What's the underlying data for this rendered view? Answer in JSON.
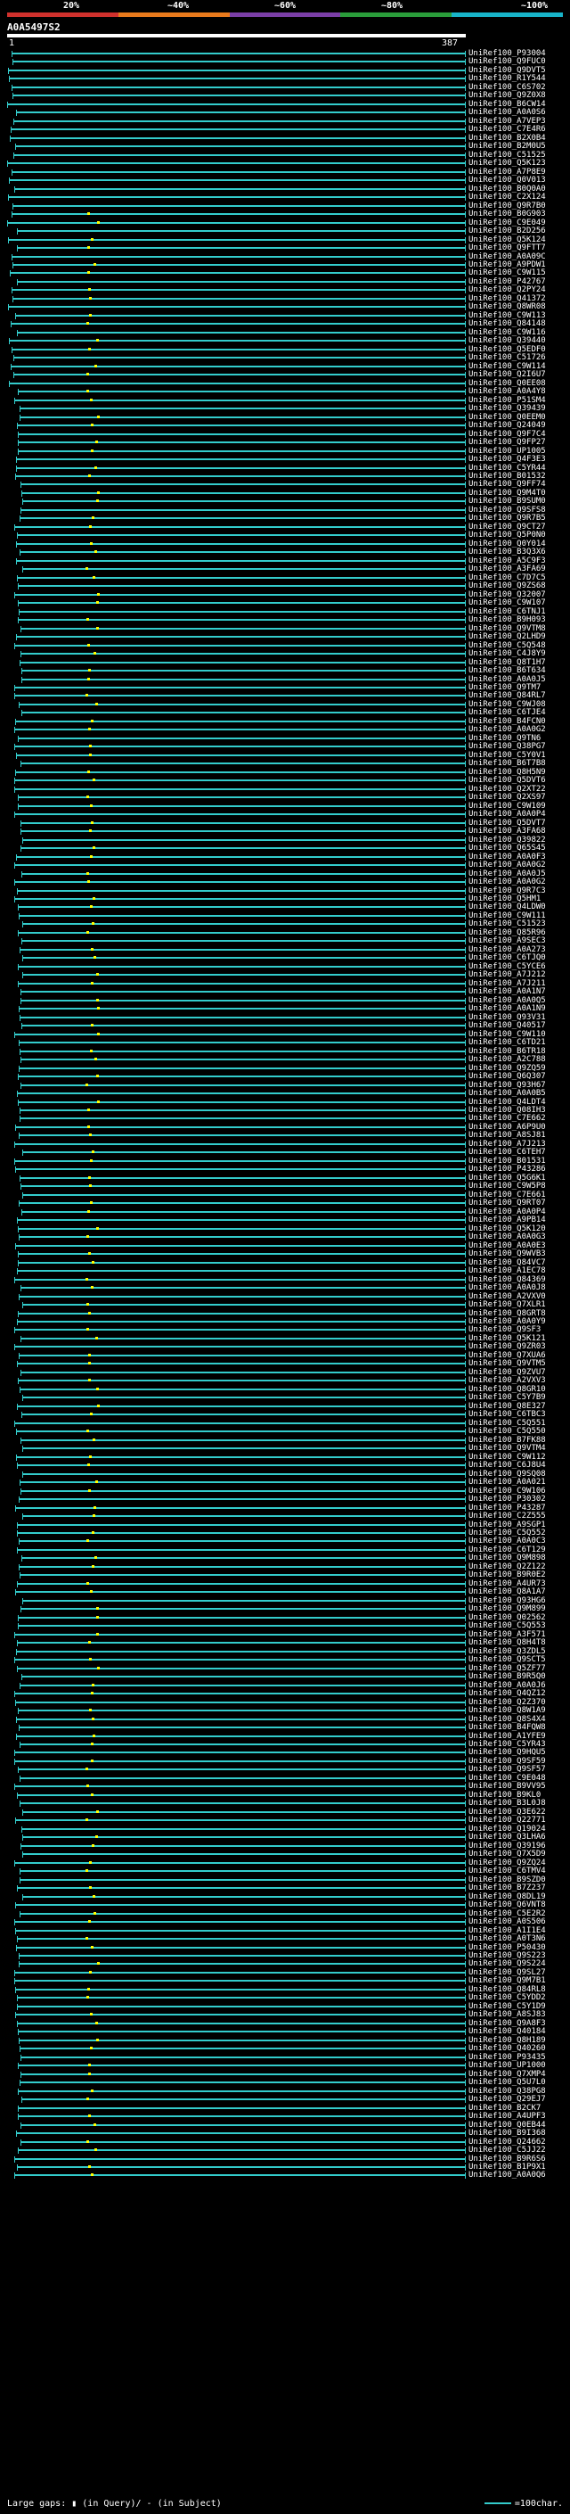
{
  "header": {
    "percent_labels": [
      "20%",
      "~40%",
      "~60%",
      "~80%",
      "~100%"
    ],
    "color_scale": [
      "#d0312d",
      "#e97a1c",
      "#7b3fa7",
      "#2a9d3a",
      "#18b4c9"
    ],
    "query_id": "A0A5497S2",
    "query_start": "1",
    "query_end": "387"
  },
  "hit_color": "#3cc",
  "hit_ids": [
    "UniRef100_P93004",
    "UniRef100_Q9FUC0",
    "UniRef100_Q9DVT5",
    "UniRef100_R1Y544",
    "UniRef100_C6S702",
    "UniRef100_Q9Z0X8",
    "UniRef100_B6CW14",
    "UniRef100_A0A0S6",
    "UniRef100_A7VEP3",
    "UniRef100_C7E4R6",
    "UniRef100_B2X0B4",
    "UniRef100_B2M0U5",
    "UniRef100_C51525",
    "UniRef100_Q5K123",
    "UniRef100_A7P8E9",
    "UniRef100_Q0V013",
    "UniRef100_B0Q0A0",
    "UniRef100_C2X124",
    "UniRef100_Q9R7B0",
    "UniRef100_B0G903",
    "UniRef100_C9E049",
    "UniRef100_B2D256",
    "UniRef100_Q5K124",
    "UniRef100_Q9FTT7",
    "UniRef100_A0A09C",
    "UniRef100_A9PDW1",
    "UniRef100_C9W115",
    "UniRef100_P42767",
    "UniRef100_Q2PY24",
    "UniRef100_Q41372",
    "UniRef100_Q8WR08",
    "UniRef100_C9W113",
    "UniRef100_Q84148",
    "UniRef100_C9W116",
    "UniRef100_Q39440",
    "UniRef100_Q5EDF0",
    "UniRef100_C51726",
    "UniRef100_C9W114",
    "UniRef100_Q2I6U7",
    "UniRef100_Q0EE08",
    "UniRef100_A0A4Y8",
    "UniRef100_P51SM4",
    "UniRef100_Q39439",
    "UniRef100_Q0EEM0",
    "UniRef100_Q24049",
    "UniRef100_Q9F7C4",
    "UniRef100_Q9FP27",
    "UniRef100_UP1005",
    "UniRef100_Q4F3E3",
    "UniRef100_C5YR44",
    "UniRef100_B01532",
    "UniRef100_Q9FF74",
    "UniRef100_Q9M4T0",
    "UniRef100_B9SUM0",
    "UniRef100_Q9SFS8",
    "UniRef100_Q9R7B5",
    "UniRef100_Q9CT27",
    "UniRef100_Q5P0N0",
    "UniRef100_Q0Y014",
    "UniRef100_B3Q3X6",
    "UniRef100_A5C9F3",
    "UniRef100_A3FA69",
    "UniRef100_C7D7C5",
    "UniRef100_Q9ZS68",
    "UniRef100_Q32007",
    "UniRef100_C9W107",
    "UniRef100_C6TNJ1",
    "UniRef100_B9H093",
    "UniRef100_Q9VTM8",
    "UniRef100_Q2LHD9",
    "UniRef100_C5Q548",
    "UniRef100_C4J8Y9",
    "UniRef100_Q8T1H7",
    "UniRef100_B6T634",
    "UniRef100_A0A0J5",
    "UniRef100_Q9TM7",
    "UniRef100_Q84RL7",
    "UniRef100_C9WJ08",
    "UniRef100_C6TJE4",
    "UniRef100_B4FCN0",
    "UniRef100_A0A0G2",
    "UniRef100_Q9TN6",
    "UniRef100_Q38PG7",
    "UniRef100_C5Y0V1",
    "UniRef100_B6T7B8",
    "UniRef100_Q8H5N9",
    "UniRef100_Q5DVT6",
    "UniRef100_Q2XT22",
    "UniRef100_Q2XS97",
    "UniRef100_C9W109",
    "UniRef100_A0A0P4",
    "UniRef100_Q5DVT7",
    "UniRef100_A3FA68",
    "UniRef100_Q39822",
    "UniRef100_Q65S45",
    "UniRef100_A0A0F3",
    "UniRef100_A0A0G2",
    "UniRef100_A0A0J5",
    "UniRef100_A0A0G2",
    "UniRef100_Q9R7C3",
    "UniRef100_Q5HM1",
    "UniRef100_Q4LDW0",
    "UniRef100_C9W111",
    "UniRef100_C51523",
    "UniRef100_Q85R96",
    "UniRef100_A9SEC3",
    "UniRef100_A0A273",
    "UniRef100_C6TJQ0",
    "UniRef100_C5YCE6",
    "UniRef100_A7J212",
    "UniRef100_A7J211",
    "UniRef100_A0A1N7",
    "UniRef100_A0A0Q5",
    "UniRef100_A0A1N9",
    "UniRef100_Q93V31",
    "UniRef100_Q40517",
    "UniRef100_C9W110",
    "UniRef100_C6TD21",
    "UniRef100_B6TR18",
    "UniRef100_A2C788",
    "UniRef100_Q9ZQ59",
    "UniRef100_Q6Q307",
    "UniRef100_Q93H67",
    "UniRef100_A0A0B5",
    "UniRef100_Q4LDT4",
    "UniRef100_Q08IH3",
    "UniRef100_C7E662",
    "UniRef100_A6P9U0",
    "UniRef100_A8SJ81",
    "UniRef100_A7J213",
    "UniRef100_C6TEH7",
    "UniRef100_B01531",
    "UniRef100_P43286",
    "UniRef100_Q5G6K1",
    "UniRef100_C9W5P8",
    "UniRef100_C7E661",
    "UniRef100_Q9RT07",
    "UniRef100_A0A0P4",
    "UniRef100_A9PB14",
    "UniRef100_Q5K120",
    "UniRef100_A0A0G3",
    "UniRef100_A0A0E3",
    "UniRef100_Q9WVB3",
    "UniRef100_Q84VC7",
    "UniRef100_A1EC78",
    "UniRef100_Q84369",
    "UniRef100_A0A0J8",
    "UniRef100_A2VXV0",
    "UniRef100_Q7XLR1",
    "UniRef100_Q8GRT8",
    "UniRef100_A0A0Y9",
    "UniRef100_Q9SF3",
    "UniRef100_Q5K121",
    "UniRef100_Q9ZR03",
    "UniRef100_Q7XUA6",
    "UniRef100_Q9VTM5",
    "UniRef100_Q9ZVU7",
    "UniRef100_A2VXV3",
    "UniRef100_Q8GR10",
    "UniRef100_C5Y7B9",
    "UniRef100_Q8E327",
    "UniRef100_C6TBC3",
    "UniRef100_C5Q551",
    "UniRef100_C5Q550",
    "UniRef100_B7FK88",
    "UniRef100_Q9VTM4",
    "UniRef100_C9W112",
    "UniRef100_C6J8U4",
    "UniRef100_Q9SQ08",
    "UniRef100_A0A021",
    "UniRef100_C9W106",
    "UniRef100_P30302",
    "UniRef100_P43287",
    "UniRef100_C2Z555",
    "UniRef100_A9SGP1",
    "UniRef100_C5Q552",
    "UniRef100_A0A0C3",
    "UniRef100_C6T129",
    "UniRef100_Q9M898",
    "UniRef100_Q2Z122",
    "UniRef100_B9R0E2",
    "UniRef100_A4UR73",
    "UniRef100_Q8A1A7",
    "UniRef100_Q93HG6",
    "UniRef100_Q9M899",
    "UniRef100_Q02562",
    "UniRef100_C5Q553",
    "UniRef100_A3F571",
    "UniRef100_Q8H4T8",
    "UniRef100_Q3ZDL5",
    "UniRef100_Q9SCT5",
    "UniRef100_Q5ZF77",
    "UniRef100_B9R5Q0",
    "UniRef100_A0A0J6",
    "UniRef100_Q4QZ12",
    "UniRef100_Q2Z370",
    "UniRef100_Q8W1A9",
    "UniRef100_Q8S4X4",
    "UniRef100_B4FQW8",
    "UniRef100_A1YFE9",
    "UniRef100_C5YR43",
    "UniRef100_Q9HQU5",
    "UniRef100_Q9SF59",
    "UniRef100_Q9SF57",
    "UniRef100_C9E048",
    "UniRef100_B9VV95",
    "UniRef100_B9KL0",
    "UniRef100_B3L0J8",
    "UniRef100_Q3E622",
    "UniRef100_Q22771",
    "UniRef100_Q19024",
    "UniRef100_Q3LHA6",
    "UniRef100_Q39196",
    "UniRef100_Q7X5D9",
    "UniRef100_Q9ZQ24",
    "UniRef100_C6TMV4",
    "UniRef100_B9SZD0",
    "UniRef100_B7Z237",
    "UniRef100_Q8DL19",
    "UniRef100_Q6VNT8",
    "UniRef100_C5E2R2",
    "UniRef100_A0S506",
    "UniRef100_A1I1E4",
    "UniRef100_A0T3N6",
    "UniRef100_P50430",
    "UniRef100_Q9S223",
    "UniRef100_Q9S224",
    "UniRef100_Q9SL27",
    "UniRef100_Q9M7B1",
    "UniRef100_Q84RL8",
    "UniRef100_C5YDD2",
    "UniRef100_C5Y1D9",
    "UniRef100_A8SJ83",
    "UniRef100_Q9A8F3",
    "UniRef100_Q40184",
    "UniRef100_Q8H189",
    "UniRef100_Q40260",
    "UniRef100_P93435",
    "UniRef100_UP1000",
    "UniRef100_Q7XMP4",
    "UniRef100_Q5U7L0",
    "UniRef100_Q38PG8",
    "UniRef100_Q29EJ7",
    "UniRef100_B2CK7",
    "UniRef100_A4UPF3",
    "UniRef100_Q0EB44",
    "UniRef100_B9I368",
    "UniRef100_Q24662",
    "UniRef100_C5JJ22",
    "UniRef100_B9R6S6",
    "UniRef100_B1P9X1",
    "UniRef100_A0A0Q6"
  ],
  "legend": {
    "gaps_label": "Large gaps: ▮ (in Query)/ - (in Subject)",
    "scale_label": "=100char."
  }
}
